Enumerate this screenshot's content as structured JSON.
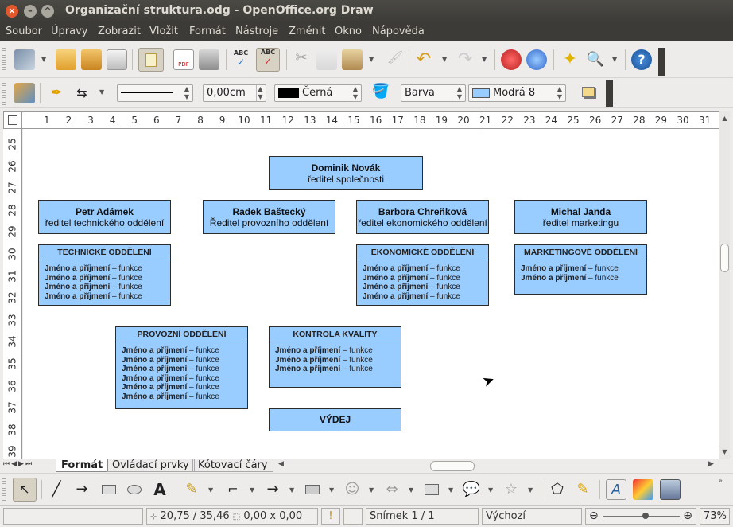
{
  "window": {
    "title": "Organizační struktura.odg - OpenOffice.org Draw"
  },
  "menu": [
    "Soubor",
    "Úpravy",
    "Zobrazit",
    "Vložit",
    "Formát",
    "Nástroje",
    "Změnit",
    "Okno",
    "Nápověda"
  ],
  "toolbar2": {
    "line_width": "0,00cm",
    "line_color": "Černá",
    "area_style": "Barva",
    "area_color": "Modrá 8",
    "line_color_hex": "#000000",
    "area_color_hex": "#99ccff"
  },
  "ruler": {
    "h": [
      "1",
      "2",
      "3",
      "4",
      "5",
      "6",
      "7",
      "8",
      "9",
      "10",
      "11",
      "12",
      "13",
      "14",
      "15",
      "16",
      "17",
      "18",
      "19",
      "20",
      "21",
      "22",
      "23",
      "24",
      "25",
      "26",
      "27",
      "28",
      "29",
      "30",
      "31"
    ],
    "v": [
      "25",
      "26",
      "27",
      "28",
      "29",
      "30",
      "31",
      "32",
      "33",
      "34",
      "35",
      "36",
      "37",
      "38",
      "39"
    ]
  },
  "chart": {
    "ceo": {
      "name": "Dominik Novák",
      "role": "ředitel společnosti"
    },
    "directors": [
      {
        "name": "Petr Adámek",
        "role": "ředitel technického oddělení"
      },
      {
        "name": "Radek Baštecký",
        "role": "Ředitel provozního oddělení"
      },
      {
        "name": "Barbora Chreňková",
        "role": "ředitel ekonomického oddělení"
      },
      {
        "name": "Michal Janda",
        "role": "ředitel marketingu"
      }
    ],
    "member_name": "Jméno a příjmení",
    "member_role": " – funkce",
    "departments": [
      {
        "title": "TECHNICKÉ ODDĚLENÍ",
        "count": 4
      },
      {
        "title": "EKONOMICKÉ ODDĚLENÍ",
        "count": 4
      },
      {
        "title": "MARKETINGOVÉ ODDĚLENÍ",
        "count": 2
      },
      {
        "title": "PROVOZNÍ ODDĚLENÍ",
        "count": 6
      },
      {
        "title": "KONTROLA KVALITY",
        "count": 3
      }
    ],
    "vydej": "VÝDEJ"
  },
  "tabs": [
    "Formát",
    "Ovládací prvky",
    "Kótovací čáry"
  ],
  "status": {
    "position": "20,75 / 35,46",
    "size": "0,00 x 0,00",
    "slide": "Snímek 1 / 1",
    "layout": "Výchozí",
    "zoom": "73%",
    "zoom_level": 0.55
  }
}
